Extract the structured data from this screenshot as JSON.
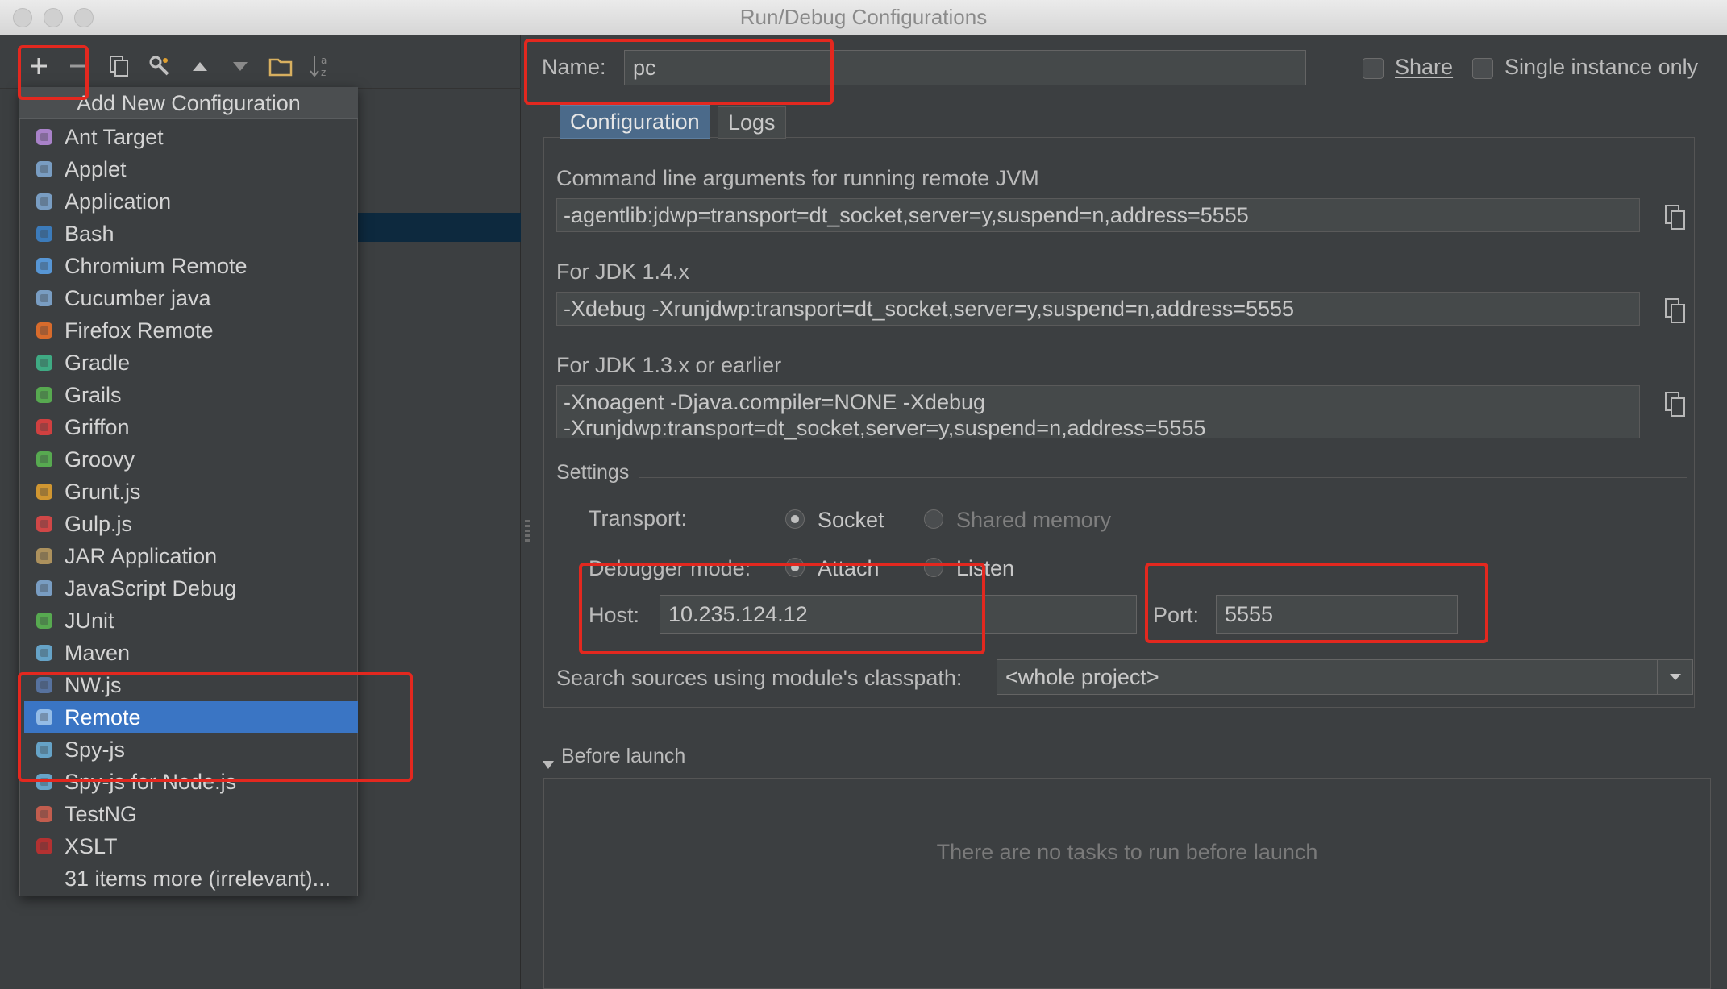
{
  "window": {
    "title": "Run/Debug Configurations"
  },
  "toolbar": {
    "icons": [
      "plus-icon",
      "minus-icon",
      "copy-icon",
      "wrench-icon",
      "arrow-up-icon",
      "arrow-down-icon",
      "folder-icon",
      "sort-az-icon"
    ]
  },
  "popup": {
    "header": "Add New Configuration",
    "items": [
      {
        "label": "Ant Target",
        "icon": "ant-icon",
        "color": "#b58ad8"
      },
      {
        "label": "Applet",
        "icon": "applet-icon",
        "color": "#7fa7d0"
      },
      {
        "label": "Application",
        "icon": "application-icon",
        "color": "#7fa7d0"
      },
      {
        "label": "Bash",
        "icon": "bash-icon",
        "color": "#3c82c8"
      },
      {
        "label": "Chromium Remote",
        "icon": "chromium-icon",
        "color": "#5aa0e6"
      },
      {
        "label": "Cucumber java",
        "icon": "cucumber-icon",
        "color": "#7fa7d0"
      },
      {
        "label": "Firefox Remote",
        "icon": "firefox-icon",
        "color": "#e8702a"
      },
      {
        "label": "Gradle",
        "icon": "gradle-icon",
        "color": "#3fb68b"
      },
      {
        "label": "Grails",
        "icon": "grails-icon",
        "color": "#5ab552"
      },
      {
        "label": "Griffon",
        "icon": "griffon-icon",
        "color": "#e04040"
      },
      {
        "label": "Groovy",
        "icon": "groovy-icon",
        "color": "#5ab552"
      },
      {
        "label": "Grunt.js",
        "icon": "grunt-icon",
        "color": "#e0a030"
      },
      {
        "label": "Gulp.js",
        "icon": "gulp-icon",
        "color": "#e04848"
      },
      {
        "label": "JAR Application",
        "icon": "jar-icon",
        "color": "#b89a60"
      },
      {
        "label": "JavaScript Debug",
        "icon": "javascript-debug-icon",
        "color": "#7fa7d0"
      },
      {
        "label": "JUnit",
        "icon": "junit-icon",
        "color": "#5ab552"
      },
      {
        "label": "Maven",
        "icon": "maven-icon",
        "color": "#6aaed6"
      },
      {
        "label": "NW.js",
        "icon": "nwjs-icon",
        "color": "#5a78a8"
      },
      {
        "label": "Remote",
        "icon": "remote-icon",
        "color": "#9fc4ea"
      },
      {
        "label": "Spy-js",
        "icon": "spyjs-icon",
        "color": "#6aaed6"
      },
      {
        "label": "Spy-js for Node.js",
        "icon": "spyjs-node-icon",
        "color": "#6aaed6"
      },
      {
        "label": "TestNG",
        "icon": "testng-icon",
        "color": "#d06050"
      },
      {
        "label": "XSLT",
        "icon": "xslt-icon",
        "color": "#c03030"
      },
      {
        "label": "31 items more (irrelevant)...",
        "icon": "",
        "color": ""
      }
    ],
    "selected": "Remote"
  },
  "form": {
    "name_label": "Name:",
    "name_value": "pc",
    "share_label": "Share",
    "single_instance_label": "Single instance only",
    "tabs": [
      "Configuration",
      "Logs"
    ],
    "cmd_label": "Command line arguments for running remote JVM",
    "cmd_value": "-agentlib:jdwp=transport=dt_socket,server=y,suspend=n,address=5555",
    "jdk14_label": "For JDK 1.4.x",
    "jdk14_value": "-Xdebug -Xrunjdwp:transport=dt_socket,server=y,suspend=n,address=5555",
    "jdk13_label": "For JDK 1.3.x or earlier",
    "jdk13_line1": "-Xnoagent -Djava.compiler=NONE -Xdebug",
    "jdk13_line2": "-Xrunjdwp:transport=dt_socket,server=y,suspend=n,address=5555",
    "settings_label": "Settings",
    "transport_label": "Transport:",
    "transport_options": [
      "Socket",
      "Shared memory"
    ],
    "transport_selected": "Socket",
    "debugger_mode_label": "Debugger mode:",
    "debugger_mode_options": [
      "Attach",
      "Listen"
    ],
    "debugger_mode_selected": "Attach",
    "host_label": "Host:",
    "host_value": "10.235.124.12",
    "port_label": "Port:",
    "port_value": "5555",
    "classpath_label": "Search sources using module's classpath:",
    "classpath_value": "<whole project>",
    "before_launch_label": "Before launch",
    "before_launch_empty": "There are no tasks to run before launch"
  },
  "colors": {
    "background": "#3c3f41",
    "selection": "#3a75c4",
    "annotation_red": "#e3281f"
  }
}
